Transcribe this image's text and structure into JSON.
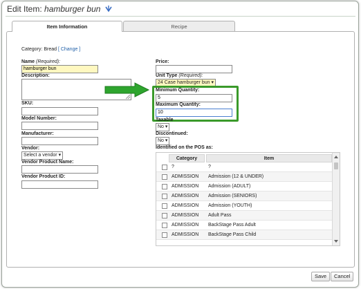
{
  "header": {
    "title_prefix": "Edit Item: ",
    "title_item": "hamburger bun"
  },
  "tabs": [
    {
      "label": "Item Information",
      "active": true
    },
    {
      "label": "Recipe",
      "active": false
    }
  ],
  "category": {
    "label": "Category:",
    "value": "Bread",
    "change_link": "[ Change ]"
  },
  "form": {
    "name_label": "Name",
    "name_required": "(Required):",
    "name_value": "hamburger bun",
    "description_label": "Description:",
    "sku_label": "SKU:",
    "model_label": "Model Number:",
    "manufacturer_label": "Manufacturer:",
    "vendor_label": "Vendor:",
    "vendor_value": "Select a vendor",
    "vendor_product_name_label": "Vendor Product Name:",
    "vendor_product_id_label": "Vendor Product ID:",
    "price_label": "Price:",
    "unit_type_label": "Unit Type",
    "unit_type_required": "(Required):",
    "unit_type_value": "24 Case hamburger bun",
    "min_qty_label": "Minimum Quantity:",
    "min_qty_value": "5",
    "max_qty_label": "Maximum Quantity:",
    "max_qty_value": "10",
    "taxable_label": "Taxable",
    "taxable_value": "No",
    "discontinued_label": "Discontinued:",
    "discontinued_value": "No",
    "pos_label": "Identified on the POS as:"
  },
  "pos_table": {
    "headers": [
      "Category",
      "Item"
    ],
    "rows": [
      {
        "category": "?",
        "item": "?"
      },
      {
        "category": "ADMISSION",
        "item": "Admission (12 & UNDER)"
      },
      {
        "category": "ADMISSION",
        "item": "Admission (ADULT)"
      },
      {
        "category": "ADMISSION",
        "item": "Admission (SENIORS)"
      },
      {
        "category": "ADMISSION",
        "item": "Admission (YOUTH)"
      },
      {
        "category": "ADMISSION",
        "item": "Adult Pass"
      },
      {
        "category": "ADMISSION",
        "item": "BackStage Pass Adult"
      },
      {
        "category": "ADMISSION",
        "item": "BackStage Pass Child"
      }
    ]
  },
  "buttons": {
    "save": "Save",
    "cancel": "Cancel"
  },
  "colors": {
    "highlight_border": "#3a9a2a",
    "arrow_fill": "#2ea52e",
    "required_bg": "#fff8c0",
    "link": "#1f5fa8"
  },
  "icons": {
    "title_icon": "pin-down-arrow-icon"
  }
}
